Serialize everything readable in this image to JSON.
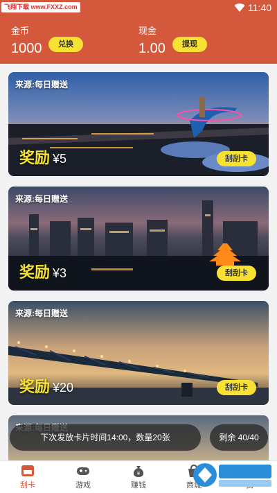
{
  "status": {
    "watermark": "飞翔下载 www.FXXZ.com",
    "time": "11:40"
  },
  "wallet": {
    "coins_label": "金币",
    "coins_value": "1000",
    "exchange_label": "兑换",
    "cash_label": "现金",
    "cash_value": "1.00",
    "withdraw_label": "提现"
  },
  "cards": [
    {
      "source": "来源:每日赠送",
      "reward_label": "奖励",
      "amount": "¥5",
      "button": "刮刮卡"
    },
    {
      "source": "来源:每日赠送",
      "reward_label": "奖励",
      "amount": "¥3",
      "button": "刮刮卡"
    },
    {
      "source": "来源:每日赠送",
      "reward_label": "奖励",
      "amount": "¥20",
      "button": "刮刮卡"
    },
    {
      "source": "来源:每日赠送"
    }
  ],
  "notice": {
    "text": "下次发放卡片时间14:00，数量20张",
    "remaining": "剩余 40/40"
  },
  "tabs": [
    {
      "label": "刮卡",
      "icon": "scratch-card-icon"
    },
    {
      "label": "游戏",
      "icon": "gamepad-icon"
    },
    {
      "label": "赚钱",
      "icon": "money-bag-icon"
    },
    {
      "label": "商城",
      "icon": "shop-icon"
    },
    {
      "label": "我",
      "icon": "user-icon"
    }
  ],
  "colors": {
    "accent": "#d4583c",
    "button": "#f7e233"
  }
}
